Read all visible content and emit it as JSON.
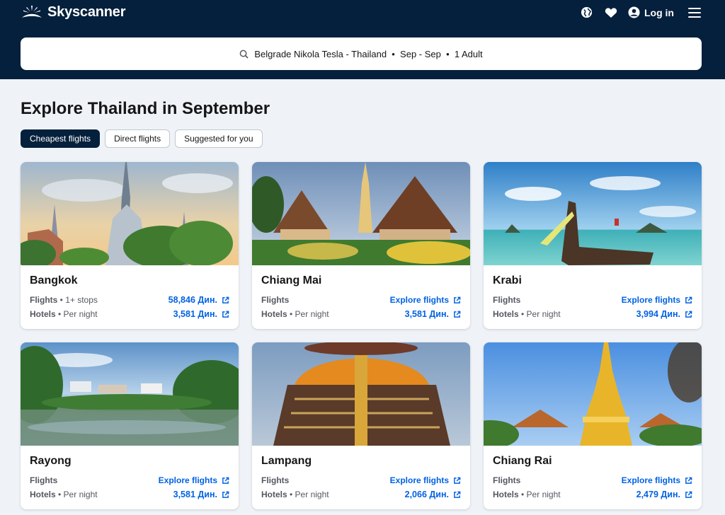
{
  "brand": {
    "name": "Skyscanner"
  },
  "header": {
    "login_label": "Log in",
    "icons": [
      "globe-icon",
      "heart-icon",
      "user-icon",
      "menu-icon"
    ]
  },
  "search": {
    "summary": "Belgrade Nikola Tesla - Thailand  •  Sep - Sep  •  1 Adult"
  },
  "page": {
    "title": "Explore Thailand in September"
  },
  "tabs": [
    {
      "label": "Cheapest flights",
      "active": true
    },
    {
      "label": "Direct flights",
      "active": false
    },
    {
      "label": "Suggested for you",
      "active": false
    }
  ],
  "cards": [
    {
      "city": "Bangkok",
      "flights_label": "Flights",
      "flights_detail": " • 1+ stops",
      "flights_value": "58,846 Дин.",
      "hotels_label": "Hotels",
      "hotels_detail": " • Per night",
      "hotels_value": "3,581 Дин."
    },
    {
      "city": "Chiang Mai",
      "flights_label": "Flights",
      "flights_detail": "",
      "flights_value": "Explore flights",
      "hotels_label": "Hotels",
      "hotels_detail": " • Per night",
      "hotels_value": "3,581 Дин."
    },
    {
      "city": "Krabi",
      "flights_label": "Flights",
      "flights_detail": "",
      "flights_value": "Explore flights",
      "hotels_label": "Hotels",
      "hotels_detail": " • Per night",
      "hotels_value": "3,994 Дин."
    },
    {
      "city": "Rayong",
      "flights_label": "Flights",
      "flights_detail": "",
      "flights_value": "Explore flights",
      "hotels_label": "Hotels",
      "hotels_detail": " • Per night",
      "hotels_value": "3,581 Дин."
    },
    {
      "city": "Lampang",
      "flights_label": "Flights",
      "flights_detail": "",
      "flights_value": "Explore flights",
      "hotels_label": "Hotels",
      "hotels_detail": " • Per night",
      "hotels_value": "2,066 Дин."
    },
    {
      "city": "Chiang Rai",
      "flights_label": "Flights",
      "flights_detail": "",
      "flights_value": "Explore flights",
      "hotels_label": "Hotels",
      "hotels_detail": " • Per night",
      "hotels_value": "2,479 Дин."
    }
  ],
  "colors": {
    "header_bg": "#05203c",
    "page_bg": "#eff3f8",
    "link": "#0062e3"
  }
}
